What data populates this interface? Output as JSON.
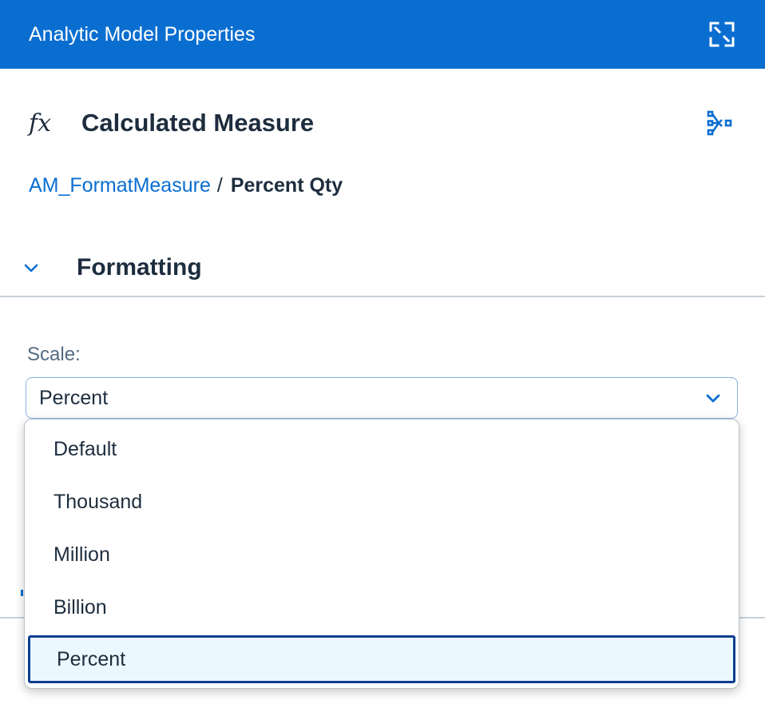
{
  "header": {
    "title": "Analytic Model Properties",
    "expand_icon": "expand-icon"
  },
  "object": {
    "icon": "fx-icon",
    "icon_glyph": "fx",
    "type_label": "Calculated Measure",
    "lineage_icon": "lineage-icon"
  },
  "breadcrumb": {
    "parent": "AM_FormatMeasure",
    "separator": "/",
    "current": "Percent Qty"
  },
  "section": {
    "title": "Formatting",
    "expanded": true
  },
  "scale": {
    "label": "Scale:",
    "value": "Percent",
    "options": [
      "Default",
      "Thousand",
      "Million",
      "Billion",
      "Percent"
    ],
    "selected": "Percent"
  },
  "colors": {
    "header_bg": "#0a6ed1",
    "link": "#0a6ed1",
    "selected_bg": "#ebf8ff",
    "selected_border": "#0b3d91"
  }
}
